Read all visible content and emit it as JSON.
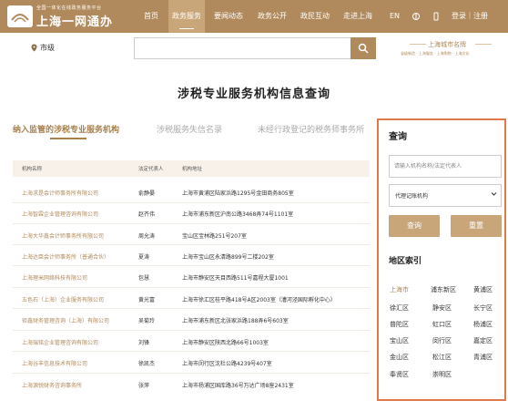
{
  "header": {
    "brand_sub": "全国一体化在线政务服务平台",
    "brand_main": "上海一网通办",
    "nav": [
      "首页",
      "政务服务",
      "要闻动态",
      "政务公开",
      "政民互动",
      "走进上海"
    ],
    "nav_active_index": 1,
    "lang": "EN",
    "login": "登录｜注册"
  },
  "location": {
    "label": "市级"
  },
  "search": {
    "placeholder": ""
  },
  "brand_right": {
    "title": "上海城市名牌",
    "sub": "省级制造 · 上海服务 · 上海购物 · 上海文化"
  },
  "page_title": "涉税专业服务机构信息查询",
  "tabs": [
    "纳入监管的涉税专业服务机构",
    "涉税服务失信名录",
    "未经行政登记的税务师事务所"
  ],
  "table": {
    "columns": [
      "机构名称",
      "法定代表人",
      "机构地址"
    ],
    "rows": [
      {
        "name": "上海求是会计师事务所有限公司",
        "rep": "俞静晏",
        "addr": "上海市黄浦区陆家浜路1295号金田商务805室"
      },
      {
        "name": "上海智霖企业管理咨询有限公司",
        "rep": "赵齐伟",
        "addr": "上海市浦东新区沪南公路3468弄74号1101室"
      },
      {
        "name": "上海大华鑫会计师事务所有限公司",
        "rep": "周允涛",
        "addr": "宝山区宝林路251号207室"
      },
      {
        "name": "上海达臣会计师事务所（普通合伙）",
        "rep": "夏涛",
        "addr": "上海市宝山区永清路899号二楼202室"
      },
      {
        "name": "上海理米网络科技有限公司",
        "rep": "包慧",
        "addr": "上海市静安区天目西路511号嘉程大厦1001"
      },
      {
        "name": "五色石（上海）企业服务有限公司",
        "rep": "黄光富",
        "addr": "上海市徐汇区桂平路418号A区2003室（漕河泾国际孵化中心）"
      },
      {
        "name": "钜鑫财务管理咨询（上海）有限公司",
        "rep": "吴菊玲",
        "addr": "上海市浦东新区北张家浜路188弄6号603室"
      },
      {
        "name": "上海瑞铭企业管理咨询有限公司",
        "rep": "刘锋",
        "addr": "上海市静安区陕西北路66号1003室"
      },
      {
        "name": "上海谷丰信息技术有限公司",
        "rep": "徐凯杰",
        "addr": "上海市闵行区沈杜公路4239号407室"
      },
      {
        "name": "上海源锐财务咨询事务所",
        "rep": "张萍",
        "addr": "上海市杨浦区国库路36号万达广场8座2431室"
      }
    ]
  },
  "panel": {
    "title": "查询",
    "input_placeholder": "请输入机构名称/法定代表人",
    "select_value": "代理记账机构",
    "query_button": "查询",
    "reset_button": "重置",
    "region_title": "地区索引",
    "regions": [
      "上海市",
      "浦东新区",
      "黄浦区",
      "徐汇区",
      "静安区",
      "长宁区",
      "普陀区",
      "虹口区",
      "杨浦区",
      "宝山区",
      "闵行区",
      "嘉定区",
      "金山区",
      "松江区",
      "青浦区",
      "奉贤区",
      "崇明区"
    ],
    "selected_region_index": 0
  },
  "colors": {
    "brand": "#b08a5c",
    "panel_border": "#e07a4a",
    "button": "#c9a679"
  }
}
